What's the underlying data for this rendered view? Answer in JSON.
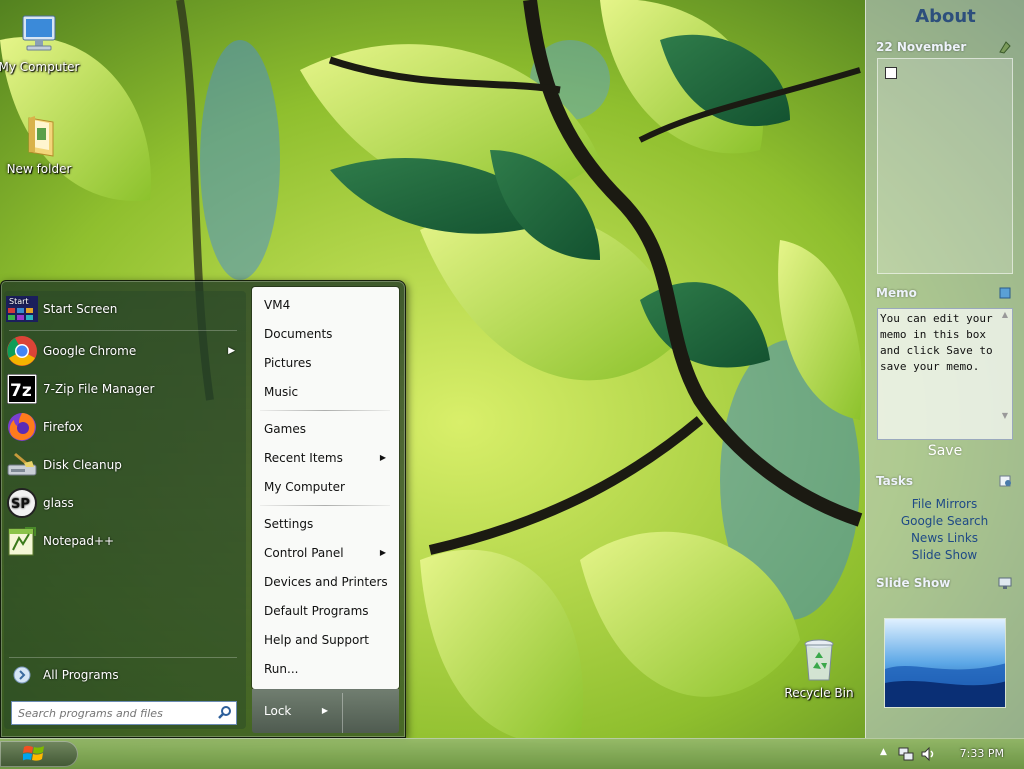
{
  "desktop": {
    "icons": [
      {
        "label": "My Computer"
      },
      {
        "label": "New folder"
      },
      {
        "label": "Recycle Bin"
      }
    ]
  },
  "start_menu": {
    "programs": [
      {
        "label": "Start Screen",
        "icon": "start-screen-icon"
      },
      {
        "label": "Google Chrome",
        "icon": "chrome-icon",
        "has_submenu": true
      },
      {
        "label": "7-Zip File Manager",
        "icon": "7zip-icon"
      },
      {
        "label": "Firefox",
        "icon": "firefox-icon"
      },
      {
        "label": "Disk Cleanup",
        "icon": "disk-cleanup-icon"
      },
      {
        "label": "glass",
        "icon": "glass-sp-icon"
      },
      {
        "label": "Notepad++",
        "icon": "notepadpp-icon"
      }
    ],
    "all_programs": "All Programs",
    "start_icon_text": "Start",
    "zip_icon_text": "7z",
    "sp_icon_text": "SP",
    "search_placeholder": "Search programs and files",
    "right_items": [
      {
        "label": "VM4"
      },
      {
        "label": "Documents"
      },
      {
        "label": "Pictures"
      },
      {
        "label": "Music"
      },
      {
        "label": "Games"
      },
      {
        "label": "Recent Items",
        "has_submenu": true
      },
      {
        "label": "My Computer"
      },
      {
        "label": "Settings"
      },
      {
        "label": "Control Panel",
        "has_submenu": true
      },
      {
        "label": "Devices and Printers"
      },
      {
        "label": "Default Programs"
      },
      {
        "label": "Help and Support"
      },
      {
        "label": "Run..."
      }
    ],
    "lock_label": "Lock",
    "submenu_arrow": "▶"
  },
  "sidebar": {
    "title": "About",
    "calendar_date": "22 November",
    "memo_title": "Memo",
    "memo_text": "You can edit your memo in this box and click Save to save your memo.",
    "memo_save": "Save",
    "tasks_title": "Tasks",
    "tasks": [
      "File Mirrors",
      "Google Search",
      "News Links",
      "Slide Show"
    ],
    "slideshow_title": "Slide Show"
  },
  "taskbar": {
    "clock": "7:33 PM",
    "tray_up_arrow": "▲"
  },
  "colors": {
    "sidebar_title": "#2d4f7c",
    "task_link": "#1f4a86"
  }
}
